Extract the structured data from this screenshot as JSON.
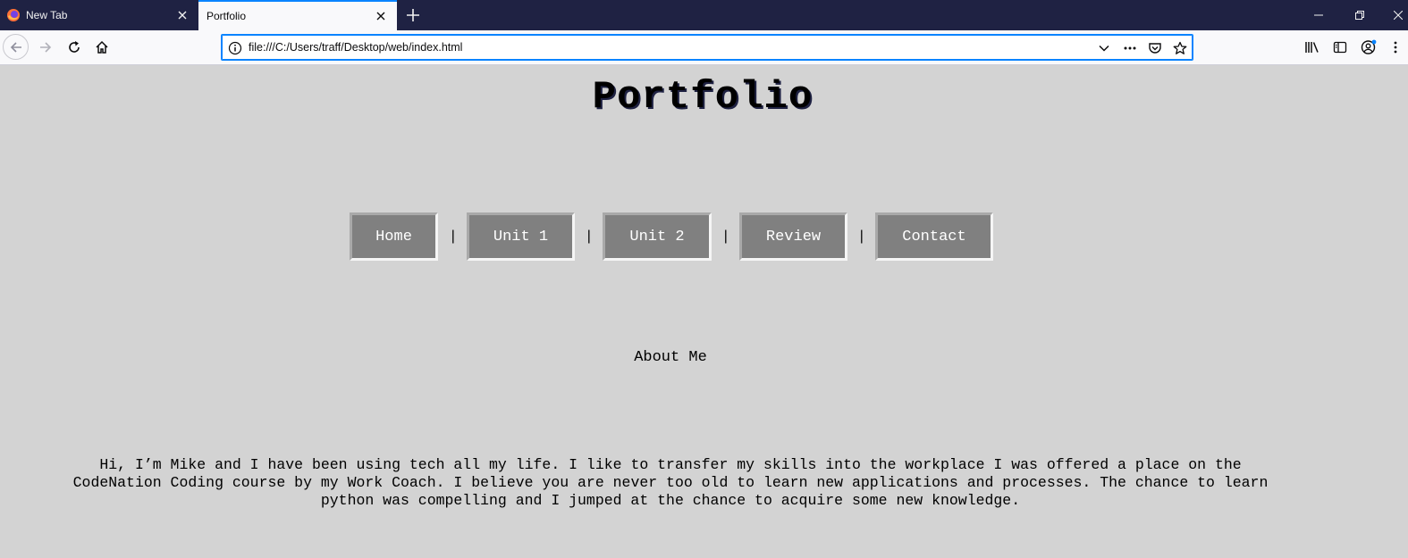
{
  "browser": {
    "tabs": [
      {
        "label": "New Tab",
        "active": false
      },
      {
        "label": "Portfolio",
        "active": true
      }
    ],
    "url": "file:///C:/Users/traff/Desktop/web/index.html",
    "colors": {
      "tabstrip": "#1f2243",
      "accent": "#0a84ff"
    }
  },
  "page": {
    "title": "Portfolio",
    "nav": {
      "items": [
        "Home",
        "Unit 1",
        "Unit 2",
        "Review",
        "Contact"
      ],
      "separator": "|"
    },
    "section_heading": "About Me",
    "bio": "Hi, I’m Mike and I have been using tech all my life. I like to transfer my skills into the workplace I was offered a place on the CodeNation Coding course by my Work Coach. I believe you are never too old to learn new applications and processes. The chance to learn python was compelling and I jumped at the chance to acquire some new knowledge.",
    "colors": {
      "background": "#d3d3d3",
      "button": "#808080",
      "button_text": "#ffffff"
    }
  }
}
